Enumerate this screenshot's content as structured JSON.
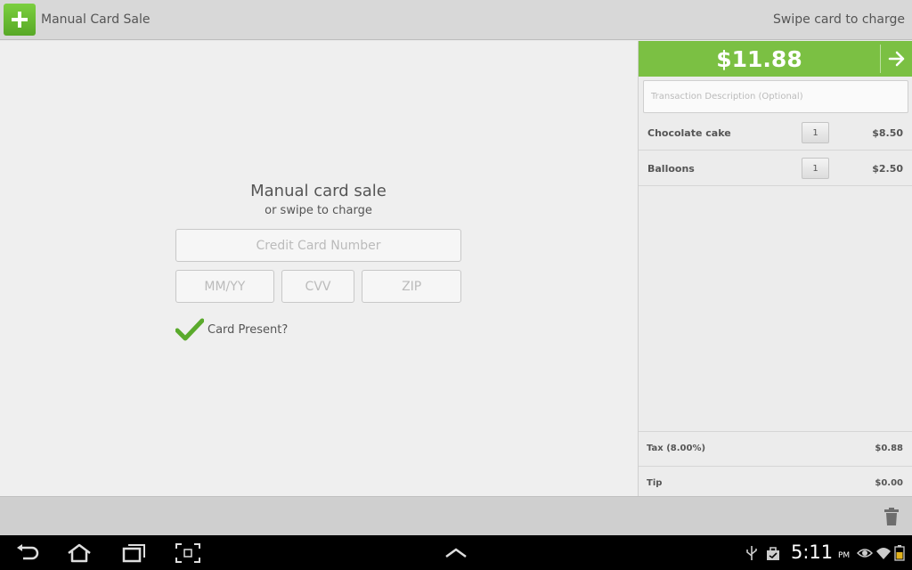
{
  "actionbar": {
    "title": "Manual Card Sale",
    "swipe_hint": "Swipe card to charge",
    "app_icon": "plus-icon"
  },
  "form": {
    "title": "Manual card sale",
    "subtitle": "or swipe to charge",
    "card_number_placeholder": "Credit Card Number",
    "expiry_placeholder": "MM/YY",
    "cvv_placeholder": "CVV",
    "zip_placeholder": "ZIP",
    "card_present_label": "Card Present?",
    "card_present_checked": true
  },
  "order": {
    "total": "$11.88",
    "description_placeholder": "Transaction Description (Optional)",
    "items": [
      {
        "name": "Chocolate cake",
        "qty": "1",
        "price": "$8.50"
      },
      {
        "name": "Balloons",
        "qty": "1",
        "price": "$2.50"
      }
    ],
    "tax_label": "Tax (8.00%)",
    "tax_value": "$0.88",
    "tip_label": "Tip",
    "tip_value": "$0.00"
  },
  "system": {
    "time": "5:11",
    "ampm": "PM"
  },
  "colors": {
    "accent": "#7bc043",
    "actionbar": "#d8d8d8",
    "text": "#555555"
  }
}
